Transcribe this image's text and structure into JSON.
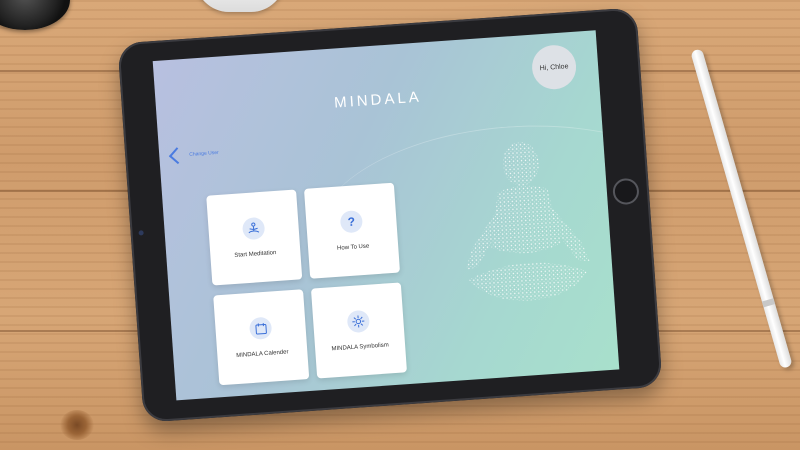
{
  "app": {
    "title": "MINDALA",
    "greeting": "Hi, Chloe",
    "back_label": "Change User"
  },
  "cards": [
    {
      "label": "Start Meditation",
      "icon": "meditation-icon"
    },
    {
      "label": "How To Use",
      "icon": "question-icon",
      "glyph": "?"
    },
    {
      "label": "MINDALA Calender",
      "icon": "calendar-icon"
    },
    {
      "label": "MINDALA Symbolism",
      "icon": "mandala-icon"
    }
  ],
  "colors": {
    "accent": "#3a6fd8",
    "screen_start": "#b8c0e0",
    "screen_end": "#a8e0cc"
  }
}
